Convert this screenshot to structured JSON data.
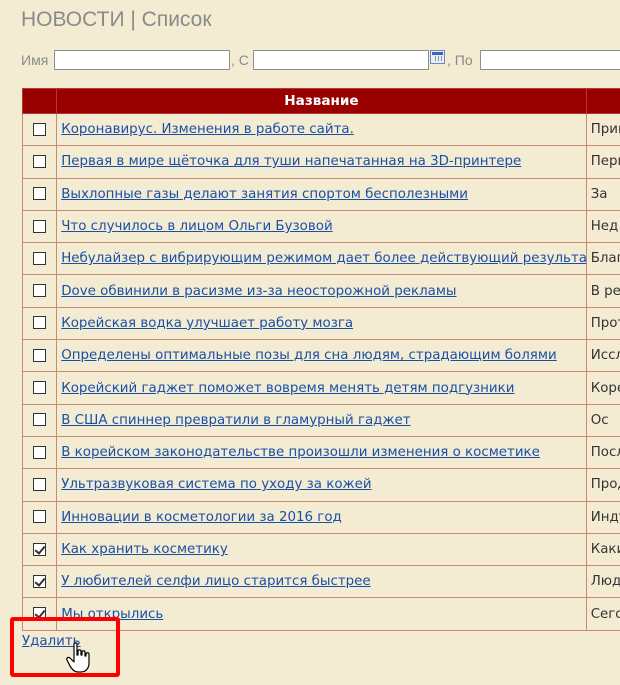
{
  "header": {
    "title": "НОВОСТИ | Список"
  },
  "filters": {
    "name_label": "Имя",
    "from_label": ", С",
    "to_label": ", По",
    "name_value": "",
    "from_value": "",
    "to_value": ""
  },
  "table": {
    "column_title": "Название",
    "rows": [
      {
        "title": "Коронавирус. Изменения в работе сайта.",
        "desc": "Прив",
        "checked": false
      },
      {
        "title": "Первая в мире щёточка для туши напечатанная на 3D-принтере",
        "desc": "Перв",
        "checked": false
      },
      {
        "title": "Выхлопные газы делают занятия спортом бесполезными",
        "desc": "За",
        "checked": false
      },
      {
        "title": "Что случилось в лицом Ольги Бузовой",
        "desc": "Нед",
        "checked": false
      },
      {
        "title": "Небулайзер с вибрирующим режимом дает более действующий результат",
        "desc": "Благо",
        "checked": false
      },
      {
        "title": "Dove обвинили в расизме из-за неосторожной рекламы",
        "desc": "В рек",
        "checked": false
      },
      {
        "title": "Корейская водка улучшает работу мозга",
        "desc": "Прот",
        "checked": false
      },
      {
        "title": "Определены оптимальные позы для сна людям, страдающим болями",
        "desc": "Иссл",
        "checked": false
      },
      {
        "title": "Корейский гаджет поможет вовремя менять детям подгузники",
        "desc": "Корей",
        "checked": false
      },
      {
        "title": "В США спиннер превратили в гламурный гаджет",
        "desc": "Ос",
        "checked": false
      },
      {
        "title": "В корейском законодательстве произошли изменения о косметике",
        "desc": "После",
        "checked": false
      },
      {
        "title": "Ультразвуковая система по уходу за кожей",
        "desc": "Прод",
        "checked": false
      },
      {
        "title": "Инновации в косметологии за 2016 год",
        "desc": "Инду",
        "checked": false
      },
      {
        "title": "Как хранить косметику",
        "desc": "Каки",
        "checked": true
      },
      {
        "title": "У любителей селфи лицо старится быстрее",
        "desc": "Люди",
        "checked": true
      },
      {
        "title": "Мы открылись",
        "desc": "Сегод",
        "checked": true
      }
    ]
  },
  "actions": {
    "delete_label": "Удалить"
  },
  "colors": {
    "header_bg": "#990000",
    "page_bg": "#f3ecd2",
    "link": "#1a4fa8",
    "highlight": "#ff0000"
  }
}
